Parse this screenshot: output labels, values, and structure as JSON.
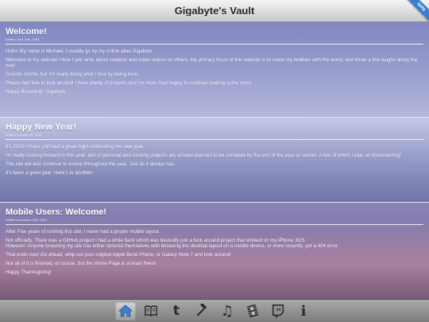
{
  "window": {
    "title": "Gigabyte's Vault",
    "ribbon": "beta"
  },
  "posts": [
    {
      "title": "Welcome!",
      "date": "Written June 19th, 2023",
      "paragraphs": [
        "Hello! My name is Michael, I usually go by my online alias Gigabyte.",
        "Welcome to my website! Here I just write about subjects and make videos on others. My primary focus of this website is to share my hobbies with the world, and throw a few laughs along the way!",
        "Sounds chiche, but I'm really doing what I love by being here.",
        "Please feel free to look around! I have plenty of projects and I'm more than happy to continue making some more.",
        "Happy Browsing! -Gigabyte"
      ]
    },
    {
      "title": "Happy New Year!",
      "date": "Written January 1st, 2025",
      "paragraphs": [
        "It's 2025! I hope y'all had a great night celebrating the new year.",
        "I'm really looking forward to this year, alot of personal and exciting projects are at least planned to be complete by the end of the year or sooner. A few of which I plan on documenting!",
        "The site will also continue to evolve throughout the year. Just as it always has.",
        "It's been a great year. Here's to another!"
      ]
    },
    {
      "title": "Mobile Users: Welcome!",
      "date": "Written November 28th, 2024",
      "paragraphs": [
        "After Five years of running this site; I never had a proper mobile layout.",
        "Not officially. There was a GitHub project I had a while back which was basically just a fuck around project that worked on my iPhone 3GS.\nHowever: Anyone browsing my site has either tortured themselves with browsing the desktop layout on a mobile device, or more recently; got a 404 error.",
        "That ends now! Go ahead, whip out your original Apple Bend Phone, or Galaxy Note 7 and look around!",
        "Not all of it is finished, of course, but the Home Page is at least there!",
        "Happy Thanksgiving!"
      ]
    }
  ],
  "toolbar": {
    "items": [
      {
        "name": "home-icon",
        "active": true
      },
      {
        "name": "book-icon"
      },
      {
        "name": "tumblr-icon",
        "glyph": "t"
      },
      {
        "name": "hammer-icon"
      },
      {
        "name": "music-note-icon",
        "glyph": "♫"
      },
      {
        "name": "film-icon"
      },
      {
        "name": "twitch-icon"
      },
      {
        "name": "info-icon",
        "glyph": "i"
      }
    ]
  }
}
